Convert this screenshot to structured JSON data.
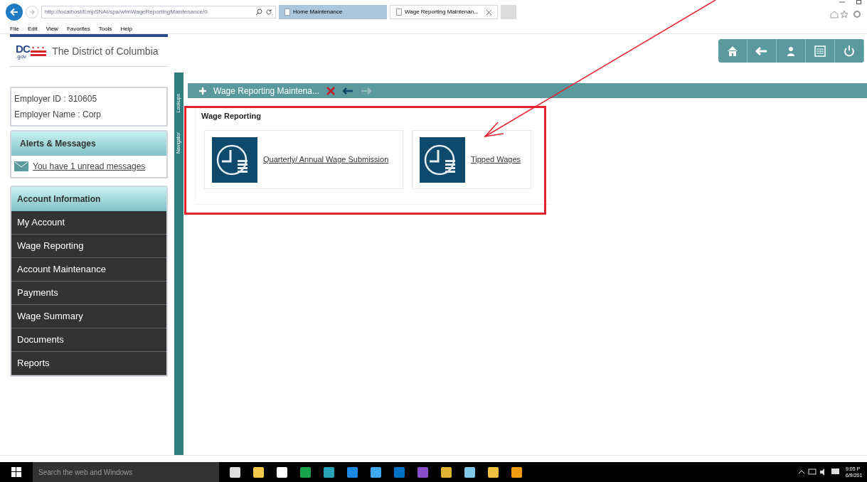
{
  "browser": {
    "url": "http://localhost/EmpSNAt/spa/wfmWageReportingMaintenance/0",
    "tabs": [
      {
        "label": "Home Maintenance",
        "selected": false
      },
      {
        "label": "Wage Reporting Maintenan...",
        "selected": true
      }
    ],
    "menu": [
      "File",
      "Edit",
      "View",
      "Favorites",
      "Tools",
      "Help"
    ]
  },
  "header": {
    "logo_top": "DC",
    "logo_bottom": ".gov",
    "title": "The District of Columbia"
  },
  "employer": {
    "lines": [
      "Employer ID : 310605",
      "Employer Name : Corp"
    ]
  },
  "alerts": {
    "title": "Alerts & Messages",
    "message": "You have 1 unread messages"
  },
  "account": {
    "title": "Account Information",
    "items": [
      "My Account",
      "Wage Reporting",
      "Account Maintenance",
      "Payments",
      "Wage Summary",
      "Documents",
      "Reports"
    ]
  },
  "side_tabs": [
    "Lookups",
    "Navigator"
  ],
  "content_tab": {
    "title": "Wage Reporting Maintena..."
  },
  "section": {
    "title": "Wage Reporting",
    "cards": [
      "Quarterly/ Annual Wage Submission",
      "Tipped Wages"
    ]
  },
  "taskbar": {
    "search_placeholder": "Search the web and Windows",
    "time": "9:05 P",
    "date": "6/9/201"
  }
}
